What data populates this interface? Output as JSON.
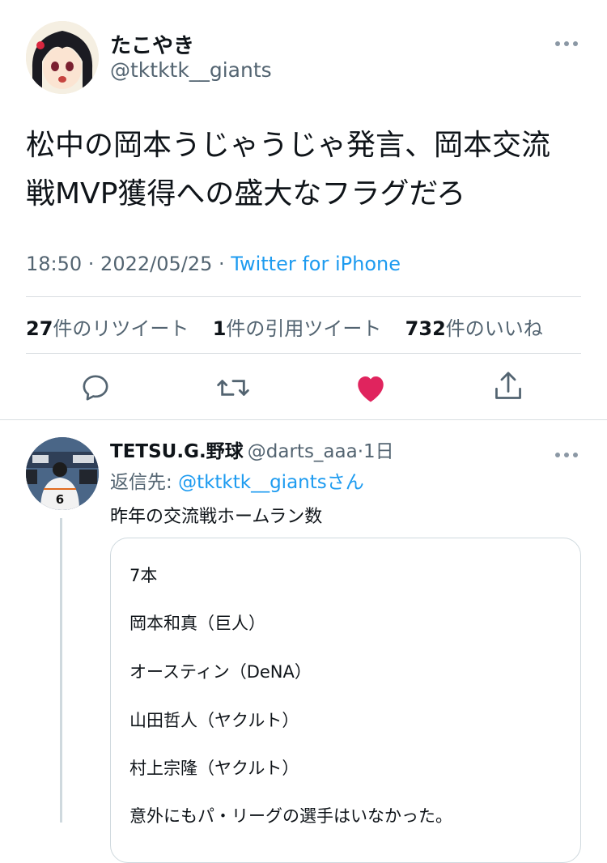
{
  "tweet": {
    "display_name": "たこやき",
    "handle": "@tktktk__giants",
    "more_icon": "more-icon",
    "text_line1": "松中の岡本うじゃうじゃ発言、岡本交流",
    "text_line2": "戦MVP獲得への盛大なフラグだろ",
    "timestamp": "18:50 · 2022/05/25 · ",
    "source": "Twitter for iPhone",
    "retweets_count": "27",
    "retweets_label": "件のリツイート",
    "quotes_count": "1",
    "quotes_label": "件の引用ツイート",
    "likes_count": "732",
    "likes_label": "件のいいね",
    "actions": [
      "reply-icon",
      "retweet-icon",
      "like-icon",
      "share-icon"
    ],
    "like_color": "#e0245e"
  },
  "reply": {
    "display_name": "TETSU.G.野球",
    "handle": "@darts_aaa",
    "time": "·1日",
    "reply_to_prefix": "返信先: ",
    "reply_to_user": "@tktktk__giants",
    "reply_to_suffix": "さん",
    "text": "昨年の交流戦ホームラン数",
    "card_lines": [
      "7本",
      "岡本和真（巨人）",
      "オースティン（DeNA）",
      "山田哲人（ヤクルト）",
      "村上宗隆（ヤクルト）",
      "意外にもパ・リーグの選手はいなかった。"
    ]
  },
  "colors": {
    "accent": "#1d9bf0",
    "text": "#0f1419",
    "muted": "#536471",
    "like": "#e0245e"
  }
}
